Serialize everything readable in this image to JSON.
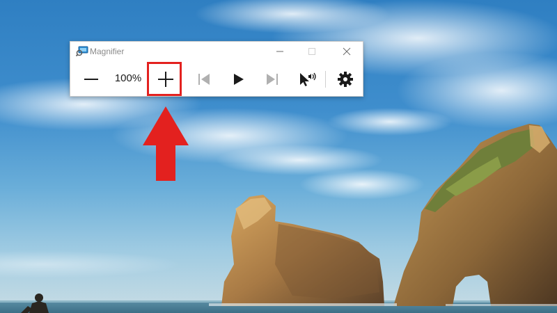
{
  "window": {
    "title": "Magnifier",
    "minimize_icon": "minimize-icon",
    "maximize_icon": "maximize-icon",
    "close_icon": "close-icon"
  },
  "toolbar": {
    "zoom_level": "100%",
    "buttons": [
      {
        "name": "zoom-out",
        "icon": "minus-icon"
      },
      {
        "name": "zoom-in",
        "icon": "plus-icon"
      },
      {
        "name": "previous",
        "icon": "skip-back-icon"
      },
      {
        "name": "play",
        "icon": "play-icon"
      },
      {
        "name": "next",
        "icon": "skip-forward-icon"
      },
      {
        "name": "read-from-here",
        "icon": "pointer-speaker-icon"
      },
      {
        "name": "settings",
        "icon": "gear-icon"
      }
    ]
  },
  "annotation": {
    "highlight_color": "#e3211f",
    "arrow_color": "#e3211f",
    "target": "zoom-in"
  },
  "colors": {
    "sky": "#3f8ecd",
    "window_bg": "#ffffff",
    "title_text": "#8a8a8a"
  }
}
